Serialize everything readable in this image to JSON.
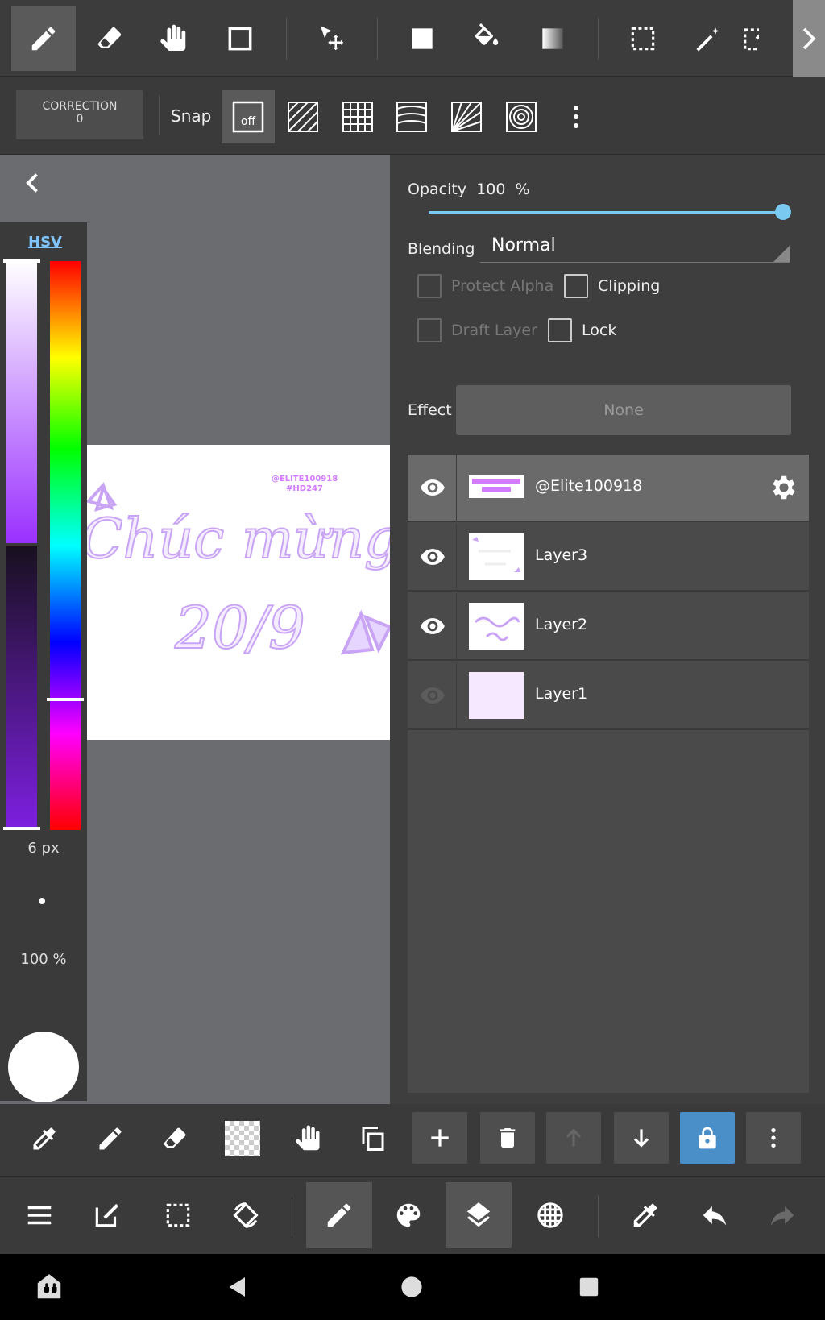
{
  "correction": {
    "label": "CORRECTION",
    "value": "0"
  },
  "snap": {
    "label": "Snap",
    "off_label": "off"
  },
  "color_panel": {
    "mode": "HSV",
    "brush_size": "6 px",
    "opacity": "100 %"
  },
  "artwork": {
    "line1": "Chúc mừng",
    "line2": "20/9",
    "stamp1": "@ELITE100918",
    "stamp2": "#HD247"
  },
  "layer_panel": {
    "opacity_label": "Opacity",
    "opacity_value": "100",
    "opacity_unit": "%",
    "opacity_fraction": 1.0,
    "blending_label": "Blending",
    "blending_value": "Normal",
    "protect_alpha": "Protect Alpha",
    "clipping": "Clipping",
    "draft_layer": "Draft Layer",
    "lock": "Lock",
    "effect_label": "Effect",
    "effect_value": "None",
    "layers": [
      {
        "name": "@Elite100918",
        "visible": true,
        "selected": true
      },
      {
        "name": "Layer3",
        "visible": true,
        "selected": false
      },
      {
        "name": "Layer2",
        "visible": true,
        "selected": false
      },
      {
        "name": "Layer1",
        "visible": false,
        "selected": false
      }
    ]
  },
  "colors": {
    "accent": "#79c9f0",
    "lock_blue": "#4a8fc8",
    "panel": "#3e3e3e",
    "canvas_bg": "#6a6c70",
    "stroke_purple": "#c9a4f5"
  }
}
